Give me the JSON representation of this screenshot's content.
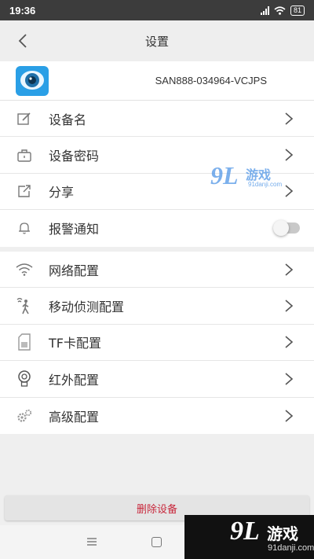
{
  "status_bar": {
    "time": "19:36",
    "battery": "81"
  },
  "header": {
    "title": "设置"
  },
  "device": {
    "id": "SAN888-034964-VCJPS"
  },
  "settings_group_1": [
    {
      "label": "设备名",
      "icon": "edit-icon",
      "control": "chevron"
    },
    {
      "label": "设备密码",
      "icon": "lock-icon",
      "control": "chevron"
    },
    {
      "label": "分享",
      "icon": "share-icon",
      "control": "chevron"
    },
    {
      "label": "报警通知",
      "icon": "bell-icon",
      "control": "toggle",
      "enabled": false
    }
  ],
  "settings_group_2": [
    {
      "label": "网络配置",
      "icon": "wifi-icon",
      "control": "chevron"
    },
    {
      "label": "移动侦测配置",
      "icon": "motion-icon",
      "control": "chevron"
    },
    {
      "label": "TF卡配置",
      "icon": "sd-card-icon",
      "control": "chevron"
    },
    {
      "label": "红外配置",
      "icon": "bulb-icon",
      "control": "chevron"
    },
    {
      "label": "高级配置",
      "icon": "gears-icon",
      "control": "chevron"
    }
  ],
  "delete_button": {
    "label": "删除设备"
  },
  "watermark": {
    "brand_number": "9L",
    "brand_cn": "游戏",
    "url": "91danji.com"
  },
  "colors": {
    "delete_text": "#c8283c",
    "accent_blue": "#2a9fe6",
    "status_bar_bg": "#3c3c3c"
  }
}
